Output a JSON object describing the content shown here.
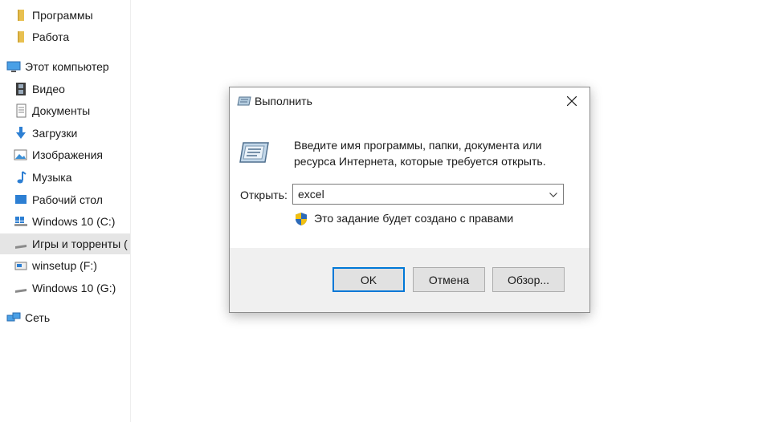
{
  "sidebar": {
    "items": [
      {
        "label": "Программы",
        "icon": "folder-icon"
      },
      {
        "label": "Работа",
        "icon": "folder-icon"
      },
      {
        "label": "Этот компьютер",
        "icon": "computer-icon"
      },
      {
        "label": "Видео",
        "icon": "video-icon"
      },
      {
        "label": "Документы",
        "icon": "documents-icon"
      },
      {
        "label": "Загрузки",
        "icon": "download-icon"
      },
      {
        "label": "Изображения",
        "icon": "pictures-icon"
      },
      {
        "label": "Музыка",
        "icon": "music-icon"
      },
      {
        "label": "Рабочий стол",
        "icon": "desktop-icon"
      },
      {
        "label": "Windows 10 (C:)",
        "icon": "windows-drive-icon"
      },
      {
        "label": "Игры и торренты (",
        "icon": "drive-icon",
        "selected": true
      },
      {
        "label": "winsetup (F:)",
        "icon": "usb-drive-icon"
      },
      {
        "label": "Windows 10 (G:)",
        "icon": "drive-icon"
      },
      {
        "label": "Сеть",
        "icon": "network-icon"
      }
    ]
  },
  "dialog": {
    "title": "Выполнить",
    "description": "Введите имя программы, папки, документа или ресурса Интернета, которые требуется открыть.",
    "open_label": "Открыть:",
    "open_value": "excel",
    "admin_note": "Это задание будет создано с правами",
    "ok_label": "OK",
    "cancel_label": "Отмена",
    "browse_label": "Обзор..."
  },
  "colors": {
    "accent": "#0078d7",
    "folder": "#e8c050",
    "selection": "#e5e5e5",
    "dialog_bg": "#f0f0f0"
  }
}
